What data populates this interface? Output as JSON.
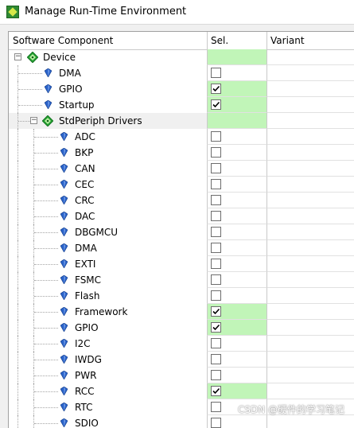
{
  "window": {
    "title": "Manage Run-Time Environment",
    "icon": "keil-pack-icon"
  },
  "columns": {
    "component": "Software Component",
    "sel": "Sel.",
    "variant": "Variant"
  },
  "rows": [
    {
      "label": "Device",
      "kind": "group",
      "level": 0,
      "expanded": true,
      "checkbox": false,
      "checked": false,
      "highlight": false,
      "sel_status": "green"
    },
    {
      "label": "DMA",
      "kind": "item",
      "level": 1,
      "checkbox": true,
      "checked": false,
      "sel_status": "none"
    },
    {
      "label": "GPIO",
      "kind": "item",
      "level": 1,
      "checkbox": true,
      "checked": true,
      "sel_status": "green"
    },
    {
      "label": "Startup",
      "kind": "item",
      "level": 1,
      "checkbox": true,
      "checked": true,
      "sel_status": "green"
    },
    {
      "label": "StdPeriph Drivers",
      "kind": "group",
      "level": 1,
      "expanded": true,
      "checkbox": false,
      "checked": false,
      "highlight": true,
      "sel_status": "green"
    },
    {
      "label": "ADC",
      "kind": "item",
      "level": 2,
      "checkbox": true,
      "checked": false,
      "sel_status": "none"
    },
    {
      "label": "BKP",
      "kind": "item",
      "level": 2,
      "checkbox": true,
      "checked": false,
      "sel_status": "none"
    },
    {
      "label": "CAN",
      "kind": "item",
      "level": 2,
      "checkbox": true,
      "checked": false,
      "sel_status": "none"
    },
    {
      "label": "CEC",
      "kind": "item",
      "level": 2,
      "checkbox": true,
      "checked": false,
      "sel_status": "none"
    },
    {
      "label": "CRC",
      "kind": "item",
      "level": 2,
      "checkbox": true,
      "checked": false,
      "sel_status": "none"
    },
    {
      "label": "DAC",
      "kind": "item",
      "level": 2,
      "checkbox": true,
      "checked": false,
      "sel_status": "none"
    },
    {
      "label": "DBGMCU",
      "kind": "item",
      "level": 2,
      "checkbox": true,
      "checked": false,
      "sel_status": "none"
    },
    {
      "label": "DMA",
      "kind": "item",
      "level": 2,
      "checkbox": true,
      "checked": false,
      "sel_status": "none"
    },
    {
      "label": "EXTI",
      "kind": "item",
      "level": 2,
      "checkbox": true,
      "checked": false,
      "sel_status": "none"
    },
    {
      "label": "FSMC",
      "kind": "item",
      "level": 2,
      "checkbox": true,
      "checked": false,
      "sel_status": "none"
    },
    {
      "label": "Flash",
      "kind": "item",
      "level": 2,
      "checkbox": true,
      "checked": false,
      "sel_status": "none"
    },
    {
      "label": "Framework",
      "kind": "item",
      "level": 2,
      "checkbox": true,
      "checked": true,
      "sel_status": "green"
    },
    {
      "label": "GPIO",
      "kind": "item",
      "level": 2,
      "checkbox": true,
      "checked": true,
      "sel_status": "green"
    },
    {
      "label": "I2C",
      "kind": "item",
      "level": 2,
      "checkbox": true,
      "checked": false,
      "sel_status": "none"
    },
    {
      "label": "IWDG",
      "kind": "item",
      "level": 2,
      "checkbox": true,
      "checked": false,
      "sel_status": "none"
    },
    {
      "label": "PWR",
      "kind": "item",
      "level": 2,
      "checkbox": true,
      "checked": false,
      "sel_status": "none"
    },
    {
      "label": "RCC",
      "kind": "item",
      "level": 2,
      "checkbox": true,
      "checked": true,
      "sel_status": "green"
    },
    {
      "label": "RTC",
      "kind": "item",
      "level": 2,
      "checkbox": true,
      "checked": false,
      "sel_status": "none"
    },
    {
      "label": "SDIO",
      "kind": "item",
      "level": 2,
      "checkbox": true,
      "checked": false,
      "sel_status": "none"
    }
  ],
  "colors": {
    "selected_green": "#c1f5b8",
    "component_gem": "#2a63c9",
    "group_diamond": "#1f9a2e"
  },
  "watermark": "CSDN @硬件的学习笔记"
}
